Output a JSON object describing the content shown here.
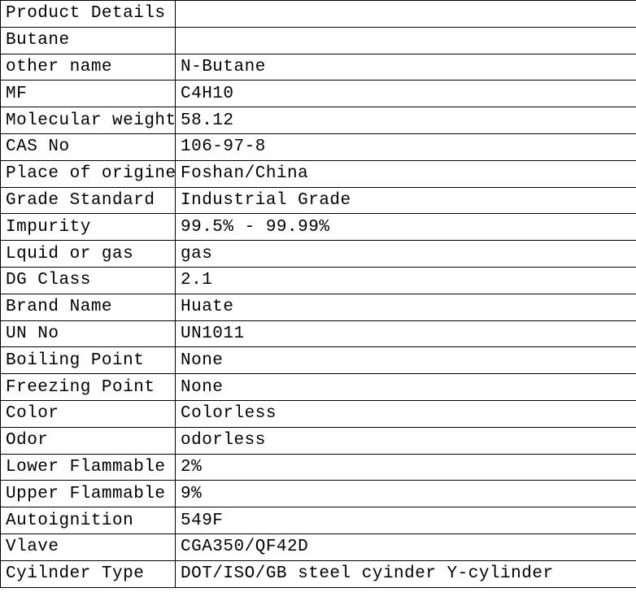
{
  "rows": [
    {
      "label": "Product Details",
      "value": ""
    },
    {
      "label": "Butane",
      "value": ""
    },
    {
      "label": "other name",
      "value": "N-Butane"
    },
    {
      "label": "MF",
      "value": "C4H10"
    },
    {
      "label": "Molecular weight",
      "value": "58.12"
    },
    {
      "label": "CAS No",
      "value": "106-97-8"
    },
    {
      "label": "Place of origine",
      "value": "Foshan/China"
    },
    {
      "label": "Grade Standard",
      "value": "Industrial Grade"
    },
    {
      "label": "Impurity",
      "value": "99.5% - 99.99%"
    },
    {
      "label": "Lquid or gas",
      "value": "gas"
    },
    {
      "label": "DG Class",
      "value": "2.1"
    },
    {
      "label": "Brand Name",
      "value": "Huate"
    },
    {
      "label": "UN No",
      "value": "UN1011"
    },
    {
      "label": "Boiling Point",
      "value": "None"
    },
    {
      "label": "Freezing Point",
      "value": "None"
    },
    {
      "label": "Color",
      "value": "Colorless"
    },
    {
      "label": "Odor",
      "value": "odorless"
    },
    {
      "label": "Lower Flammable Li",
      "value": "2%"
    },
    {
      "label": "Upper Flammable li",
      "value": "9%"
    },
    {
      "label": "Autoignition",
      "value": "549F"
    },
    {
      "label": "Vlave",
      "value": "CGA350/QF42D"
    },
    {
      "label": "Cyilnder Type",
      "value": "DOT/ISO/GB steel cyinder  Y-cylinder"
    }
  ]
}
